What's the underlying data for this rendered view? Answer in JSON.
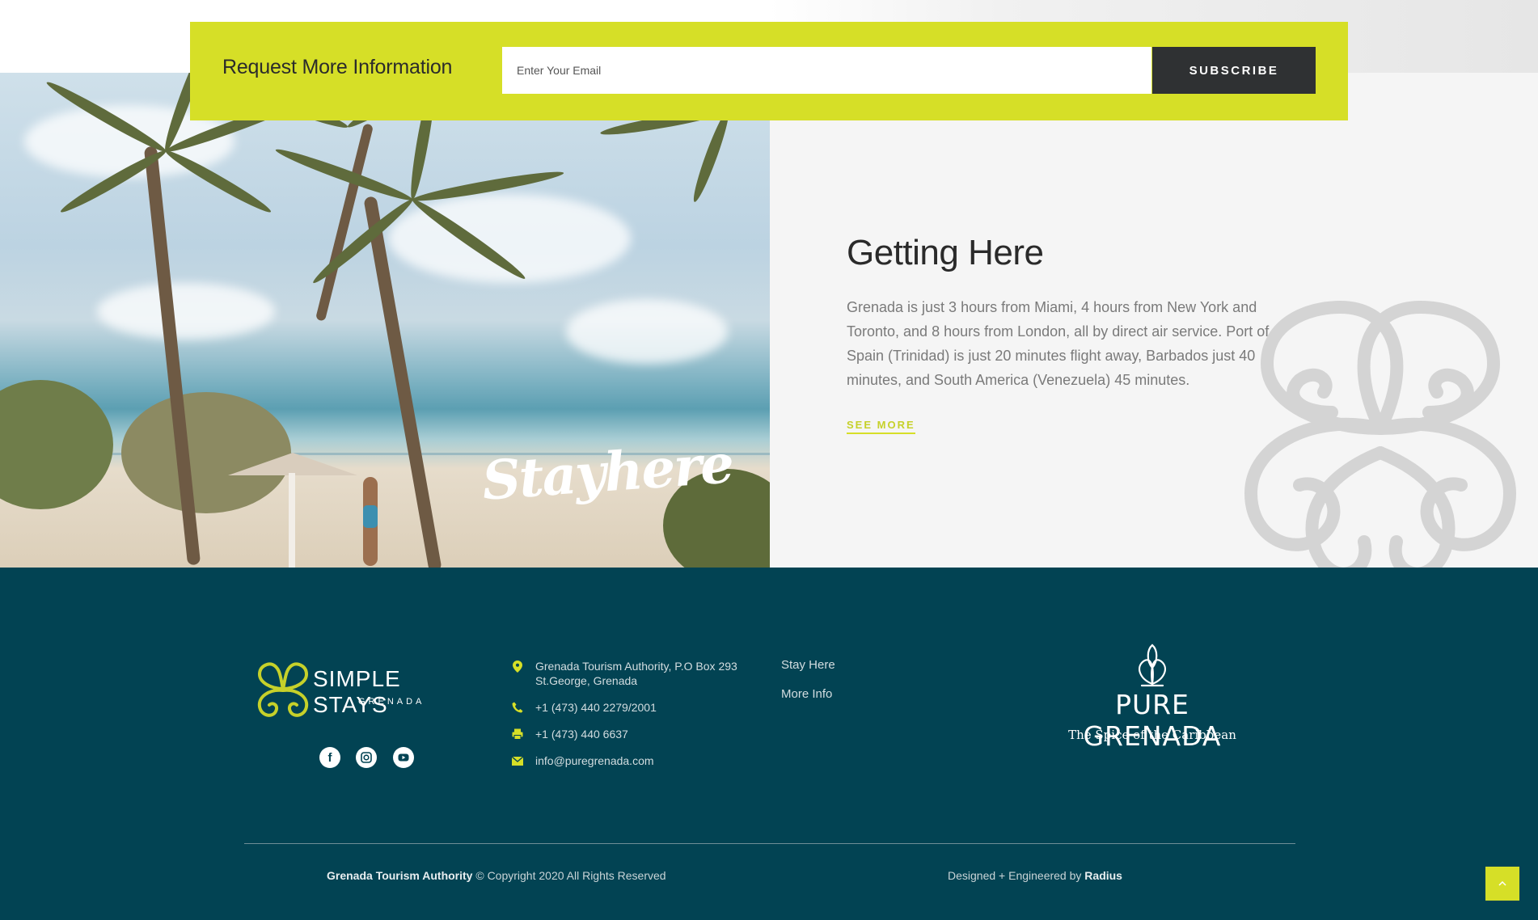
{
  "subscribe": {
    "title": "Request More Information",
    "email_placeholder": "Enter Your Email",
    "button_label": "SUBSCRIBE"
  },
  "hero": {
    "overlay_text": "Stayhere"
  },
  "getting_here": {
    "title": "Getting Here",
    "body": "Grenada is just 3 hours from Miami, 4 hours from New York and Toronto, and 8 hours from London, all by direct air service. Port of Spain (Trinidad) is just 20 minutes flight away, Barbados just 40 minutes, and South America (Venezuela) 45 minutes.",
    "see_more_label": "SEE MORE"
  },
  "footer": {
    "logo_name": "SIMPLE STAYS",
    "logo_sub": "GRENADA",
    "social": [
      {
        "icon": "facebook-icon"
      },
      {
        "icon": "instagram-icon"
      },
      {
        "icon": "youtube-icon"
      }
    ],
    "contact": {
      "address_line1": "Grenada Tourism Authority, P.O Box 293",
      "address_line2": "St.George, Grenada",
      "phone": "+1 (473) 440 2279/2001",
      "fax": "+1 (473) 440 6637",
      "email": "info@puregrenada.com"
    },
    "links": [
      "Stay Here",
      "More Info"
    ],
    "brand": {
      "title": "PURE GRENADA",
      "tagline": "The Spice of the Caribbean"
    },
    "copyright_org": "Grenada Tourism Authority",
    "copyright_text": " © Copyright 2020 All Rights Reserved",
    "credits_text": "Designed + Engineered by ",
    "credits_org": "Radius"
  },
  "colors": {
    "accent": "#d6df27",
    "footer_bg": "#024353",
    "dark_button": "#2f3133",
    "panel_bg": "#f5f5f5"
  }
}
